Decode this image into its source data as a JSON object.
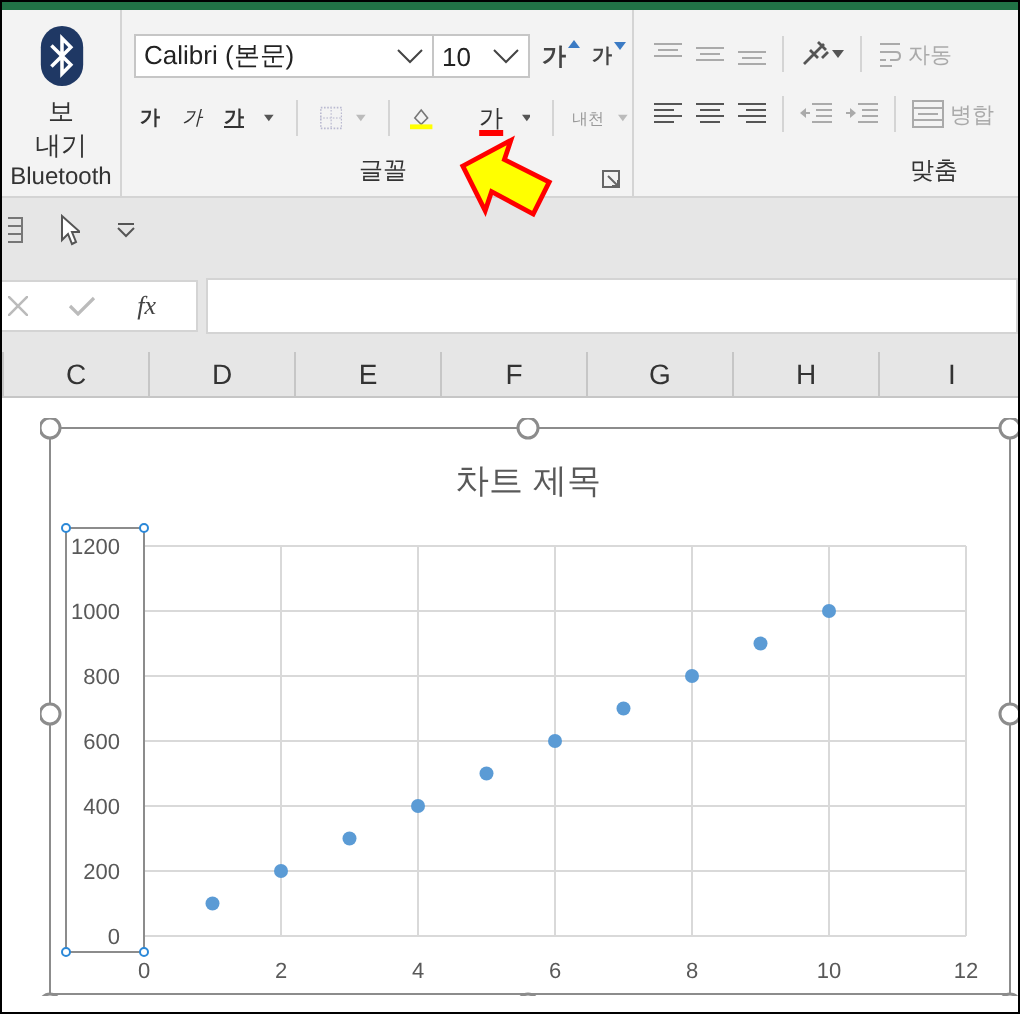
{
  "ribbon": {
    "bluetooth_group": {
      "button_lines": [
        "보",
        "내기"
      ],
      "label": "Bluetooth"
    },
    "font_group": {
      "font_name": "Calibri (본문)",
      "font_size": "10",
      "grow_label": "가",
      "shrink_label": "가",
      "style_buttons": [
        {
          "label": "가",
          "kind": "bold"
        },
        {
          "label": "가",
          "kind": "italic"
        },
        {
          "label": "가",
          "kind": "underline"
        }
      ],
      "font_color_label": "가",
      "phonetic_label": "내천",
      "label": "글꼴"
    },
    "alignment_group": {
      "wrap_label": "자동",
      "merge_label": "병합",
      "label": "맞춤"
    }
  },
  "formula_bar": {
    "function_label": "fx"
  },
  "columns": [
    "C",
    "D",
    "E",
    "F",
    "G",
    "H",
    "I"
  ],
  "chart": {
    "chart_data": {
      "type": "scatter",
      "title": "차트 제목",
      "x": [
        1,
        2,
        3,
        4,
        5,
        6,
        7,
        8,
        9,
        10
      ],
      "grid": true,
      "series": [
        {
          "color": "#5b9bd5",
          "values": [
            100,
            200,
            300,
            400,
            500,
            600,
            700,
            800,
            900,
            1000
          ]
        }
      ],
      "xlim": [
        0,
        12
      ],
      "ylim": [
        0,
        1200
      ],
      "xticks": [
        0,
        2,
        4,
        6,
        8,
        10,
        12
      ],
      "yticks": [
        0,
        200,
        400,
        600,
        800,
        1000,
        1200
      ]
    }
  }
}
